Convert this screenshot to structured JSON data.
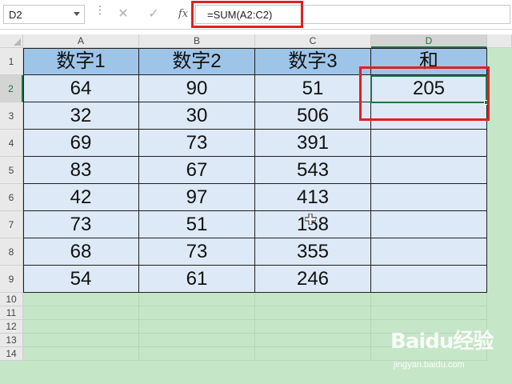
{
  "formula_bar": {
    "name_box": "D2",
    "fx_label": "fx",
    "formula": "=SUM(A2:C2)"
  },
  "columns": [
    "A",
    "B",
    "C",
    "D"
  ],
  "rows": [
    "1",
    "2",
    "3",
    "4",
    "5",
    "6",
    "7",
    "8",
    "9",
    "10",
    "11",
    "12",
    "13",
    "14"
  ],
  "table": {
    "headers": [
      "数字1",
      "数字2",
      "数字3",
      "和"
    ],
    "data": [
      [
        "64",
        "90",
        "51",
        "205"
      ],
      [
        "32",
        "30",
        "506",
        ""
      ],
      [
        "69",
        "73",
        "391",
        ""
      ],
      [
        "83",
        "67",
        "543",
        ""
      ],
      [
        "42",
        "97",
        "413",
        ""
      ],
      [
        "73",
        "51",
        "158",
        ""
      ],
      [
        "68",
        "73",
        "355",
        ""
      ],
      [
        "54",
        "61",
        "246",
        ""
      ]
    ]
  },
  "selection": {
    "active_cell": "D2",
    "active_column": "D",
    "active_row": "2"
  },
  "watermark": {
    "logo": "Baidu经验",
    "url": "jingyan.baidu.com"
  },
  "colors": {
    "header_fill": "#9ec5e8",
    "cell_fill": "#dde9f6",
    "sheet_background": "#c6e6c8",
    "selection": "#217346",
    "highlight": "#e02020"
  }
}
